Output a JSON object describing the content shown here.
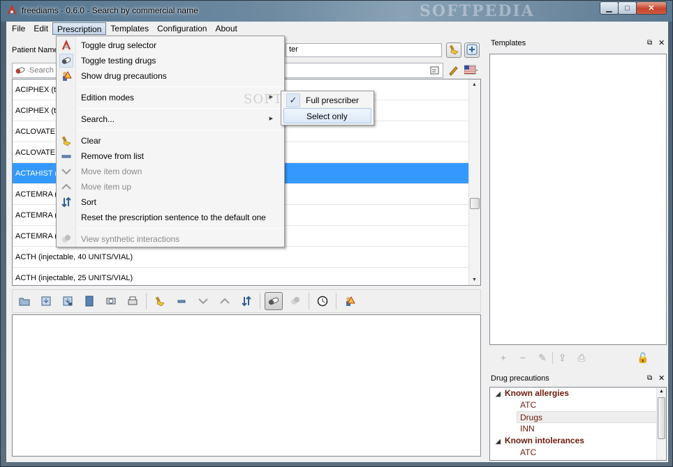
{
  "window": {
    "title": "freediams - 0.6.0 - Search by commercial name",
    "watermark": "SOFTPEDIA",
    "controls": {
      "minimize": "▁",
      "maximize": "□",
      "close": "✕"
    }
  },
  "menubar": [
    "File",
    "Edit",
    "Prescription",
    "Templates",
    "Configuration",
    "About"
  ],
  "patient": {
    "label": "Patient Name",
    "input_value": "ter"
  },
  "search": {
    "placeholder": "Search b"
  },
  "drug_list": [
    "ACIPHEX (ta",
    "ACIPHEX (ta",
    "ACLOVATE (",
    "ACLOVATE (",
    "ACTAHIST (s",
    "ACTEMRA (i",
    "ACTEMRA (i",
    "ACTEMRA (i",
    "ACTH (injectable, 40 UNITS/VIAL)",
    "ACTH (injectable, 25 UNITS/VIAL)"
  ],
  "selected_drug_index": 4,
  "prescription_menu": {
    "items": [
      {
        "label": "Toggle drug selector",
        "icon": "drug-selector-icon",
        "enabled": true
      },
      {
        "label": "Toggle testing drugs",
        "icon": "pill-icon",
        "enabled": true,
        "checked": true
      },
      {
        "label": "Show drug precautions",
        "icon": "precautions-icon",
        "enabled": true
      },
      {
        "label": "Edition modes",
        "submenu": true
      },
      {
        "label": "Search...",
        "submenu": true
      },
      {
        "label": "Clear",
        "icon": "broom-icon",
        "enabled": true
      },
      {
        "label": "Remove from list",
        "icon": "minus-icon",
        "enabled": true
      },
      {
        "label": "Move item down",
        "icon": "chevron-down-icon",
        "enabled": false
      },
      {
        "label": "Move item up",
        "icon": "chevron-up-icon",
        "enabled": false
      },
      {
        "label": "Sort",
        "icon": "sort-icon",
        "enabled": true
      },
      {
        "label": "Reset the prescription sentence to the default one",
        "enabled": true
      },
      {
        "label": "View synthetic interactions",
        "icon": "interactions-icon",
        "enabled": false
      }
    ]
  },
  "edition_modes_submenu": [
    {
      "label": "Full prescriber",
      "checked": true
    },
    {
      "label": "Select only",
      "checked": false
    }
  ],
  "submenu_watermark": "SOFTPEDIA",
  "templates_dock": {
    "title": "Templates"
  },
  "precautions_dock": {
    "title": "Drug precautions",
    "tree": [
      {
        "type": "cat",
        "label": "Known allergies"
      },
      {
        "type": "leaf",
        "label": "ATC"
      },
      {
        "type": "leaf",
        "label": "Drugs",
        "highlight": true
      },
      {
        "type": "leaf",
        "label": "INN"
      },
      {
        "type": "cat",
        "label": "Known intolerances"
      },
      {
        "type": "leaf",
        "label": "ATC"
      }
    ]
  },
  "colors": {
    "selection": "#3399ff",
    "category_text": "#6d1b0c"
  }
}
